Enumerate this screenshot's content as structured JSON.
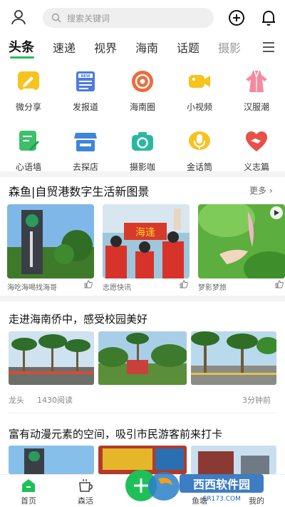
{
  "header": {
    "search_placeholder": "搜索关键词",
    "icons": [
      "user-icon",
      "search-icon",
      "plus-circle-icon",
      "bell-icon"
    ]
  },
  "tabs": [
    "头条",
    "速递",
    "视界",
    "海南",
    "话题",
    "摄影"
  ],
  "colors": {
    "accent": "#1ec05a"
  },
  "grid": [
    {
      "label": "微分享",
      "icon": "share-pen-icon",
      "color": "#f7c31f"
    },
    {
      "label": "发报道",
      "icon": "news-icon",
      "color": "#4d7be0"
    },
    {
      "label": "海南圈",
      "icon": "target-circle-icon",
      "color": "#f06a3a"
    },
    {
      "label": "小视频",
      "icon": "video-camera-icon",
      "color": "#f7c31f"
    },
    {
      "label": "汉服潮",
      "icon": "hanfu-dress-icon",
      "color": "#f48aa0"
    },
    {
      "label": "心语墙",
      "icon": "note-edit-icon",
      "color": "#3dbf6b"
    },
    {
      "label": "去探店",
      "icon": "store-icon",
      "color": "#3e86d9"
    },
    {
      "label": "摄影咖",
      "icon": "camera-icon",
      "color": "#28b8a0"
    },
    {
      "label": "金话筒",
      "icon": "microphone-icon",
      "color": "#f7c31f"
    },
    {
      "label": "义志篇",
      "icon": "heart-hand-icon",
      "color": "#e8504a"
    }
  ],
  "section1": {
    "title": "森鱼|自贸港数字生活新图景",
    "more": "更多",
    "cards": [
      {
        "caption": "海吃海喝找海哥"
      },
      {
        "caption": "志愿快讯"
      },
      {
        "caption": "梦影梦旅"
      }
    ]
  },
  "article1": {
    "title": "走进海南侨中，感受校园美好",
    "source": "龙头",
    "reads": "1430阅读",
    "time": "3分钟前"
  },
  "article2": {
    "title": "富有动漫元素的空间，吸引市民游客前来打卡"
  },
  "bottom_nav": [
    {
      "label": "首页"
    },
    {
      "label": "森活"
    },
    {
      "label": "鱼塘"
    },
    {
      "label": "我的"
    }
  ],
  "watermark": {
    "text": "西西软件园",
    "url_text": "CR173.COM"
  }
}
